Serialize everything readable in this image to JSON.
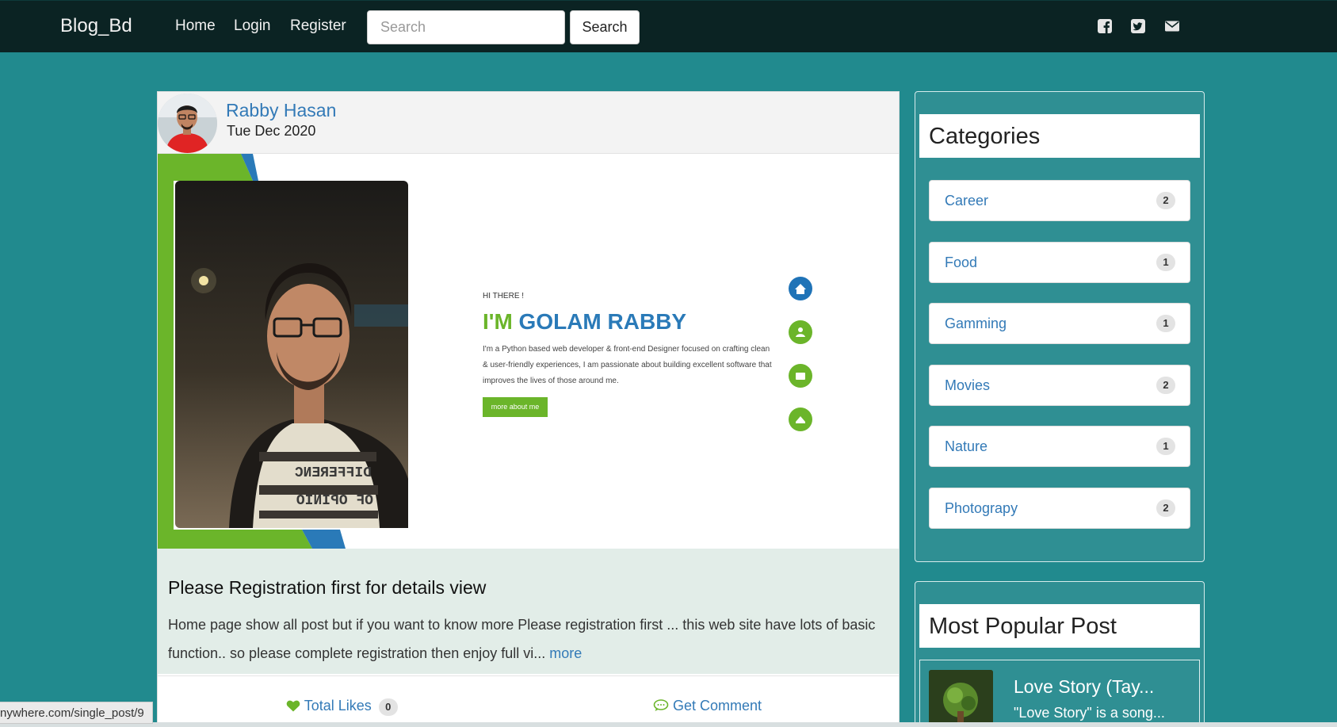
{
  "navbar": {
    "brand": "Blog_Bd",
    "links": [
      "Home",
      "Login",
      "Register"
    ],
    "search_placeholder": "Search",
    "search_button": "Search",
    "social_icons": [
      "facebook-square-icon",
      "twitter-square-icon",
      "envelope-icon"
    ]
  },
  "post": {
    "author": "Rabby Hasan",
    "date": "Tue Dec 2020",
    "image": {
      "greeting": "HI THERE !",
      "name_prefix": "I'M",
      "name": "GOLAM RABBY",
      "intro": "I'm a Python based web developer & front-end Designer focused on crafting clean & user-friendly experiences, I am passionate about building excellent software that improves the lives of those around me.",
      "button": "more about me",
      "shirt_text_1": "DIFFERENC",
      "shirt_text_2": "OF OPINIO"
    },
    "title": "Please Registration first for details view",
    "excerpt": "Home page show all post but if you want to know more Please registration first ... this web site have lots of basic function.. so please complete registration then enjoy full vi...",
    "more_link": "more",
    "likes_label": "Total Likes",
    "likes_count": "0",
    "comment_label": "Get Comment"
  },
  "sidebar": {
    "categories_title": "Categories",
    "categories": [
      {
        "name": "Career",
        "count": "2"
      },
      {
        "name": "Food",
        "count": "1"
      },
      {
        "name": "Gamming",
        "count": "1"
      },
      {
        "name": "Movies",
        "count": "2"
      },
      {
        "name": "Nature",
        "count": "1"
      },
      {
        "name": "Photograpy",
        "count": "2"
      }
    ],
    "popular_title": "Most Popular Post",
    "popular": [
      {
        "title": "Love Story (Tay...",
        "excerpt": "\"Love Story\" is a song..."
      }
    ]
  },
  "status_bar": "nywhere.com/single_post/9",
  "colors": {
    "navbar": "#0b2323",
    "background": "#218a8e",
    "link": "#337ab7",
    "accent_green": "#6bb52a",
    "accent_blue": "#2a7ab8"
  }
}
